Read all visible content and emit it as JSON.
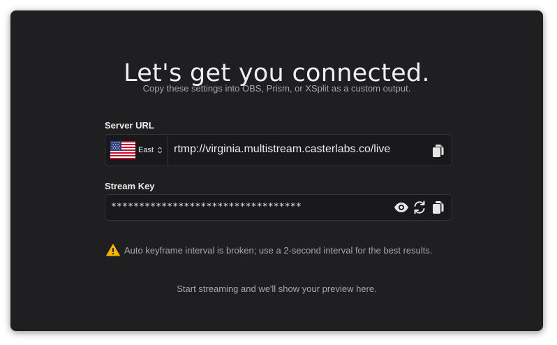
{
  "header": {
    "title": "Let's get you connected.",
    "subtitle": "Copy these settings into OBS, Prism, or XSplit as a custom output."
  },
  "server": {
    "label": "Server URL",
    "region": "East",
    "region_flag": "us-flag-icon",
    "url": "rtmp://virginia.multistream.casterlabs.co/live"
  },
  "stream_key": {
    "label": "Stream Key",
    "masked_value": "**********************************"
  },
  "warning": {
    "icon": "warning-triangle-icon",
    "text": "Auto keyframe interval is broken; use a 2-second interval for the best results.",
    "color": "#f5b400"
  },
  "preview": {
    "text": "Start streaming and we'll show your preview here."
  },
  "colors": {
    "card_background": "#1f1e20",
    "field_background": "#19181a",
    "field_border": "#353437"
  }
}
